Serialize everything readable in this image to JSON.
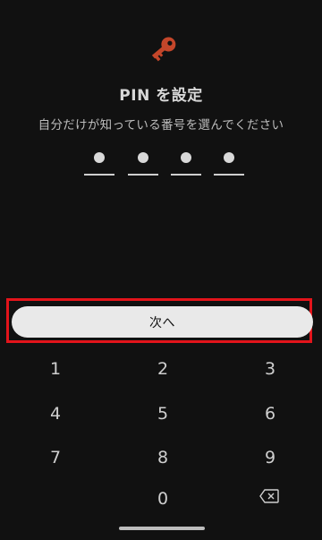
{
  "header": {
    "icon": "key-icon",
    "icon_color": "#c4462a",
    "title": "PIN を設定",
    "subtitle": "自分だけが知っている番号を選んでください"
  },
  "pin": {
    "length": 4,
    "entered": 4
  },
  "next_button": {
    "label": "次へ"
  },
  "highlight_color": "#e3141b",
  "keypad": {
    "keys": [
      "1",
      "2",
      "3",
      "4",
      "5",
      "6",
      "7",
      "8",
      "9",
      "0"
    ],
    "backspace_icon": "backspace-icon"
  }
}
